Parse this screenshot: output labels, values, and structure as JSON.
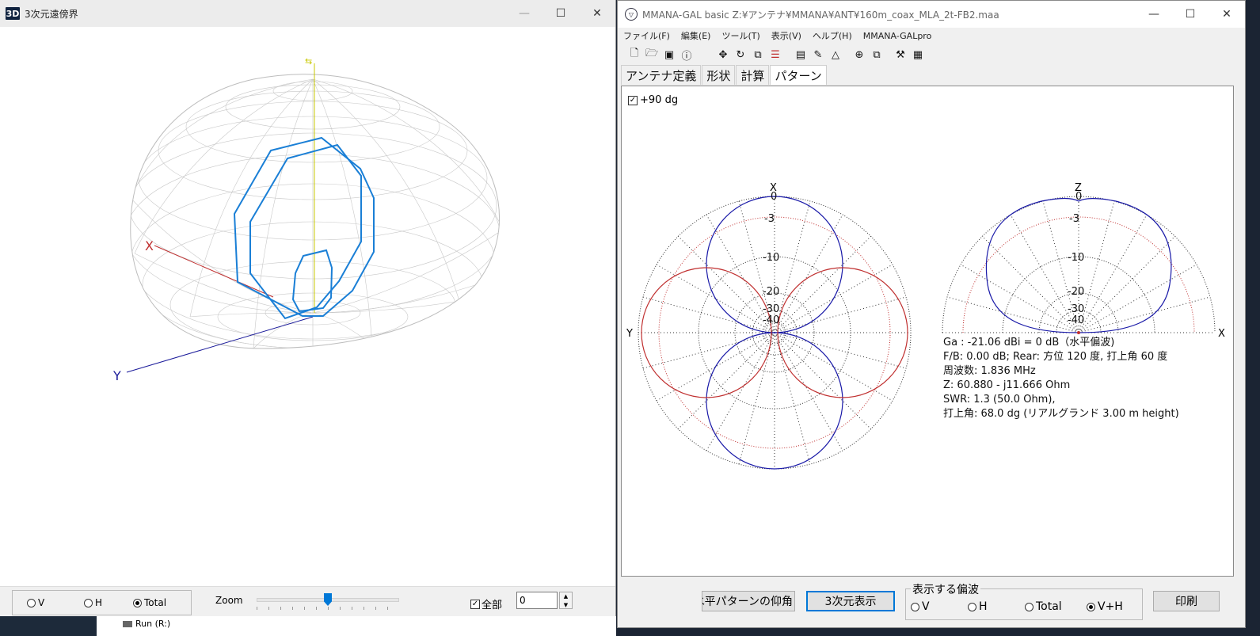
{
  "win3d": {
    "title": "3次元遠傍界",
    "icon_label": "3D",
    "axis_x": "X",
    "axis_y": "Y",
    "radio_v": "V",
    "radio_h": "H",
    "radio_total": "Total",
    "zoom_label": "Zoom",
    "zoom_level": 0.5,
    "all_checkbox_label": "全部",
    "spin_value": "0",
    "task_run_label": "Run (R:)"
  },
  "mmana": {
    "title": "MMANA-GAL basic Z:¥アンテナ¥MMANA¥ANT¥160m_coax_MLA_2t-FB2.maa",
    "menu": [
      "ファイル(F)",
      "編集(E)",
      "ツール(T)",
      "表示(V)",
      "ヘルプ(H)",
      "MMANA-GALpro"
    ],
    "tabs": [
      "アンテナ定義",
      "形状",
      "計算",
      "パターン"
    ],
    "check_90": "+90 dg",
    "horiz_plot": {
      "top_label": "X",
      "left_label": "Y",
      "ring_labels": [
        "0",
        "-3",
        "-10",
        "-20",
        "-30",
        "-40"
      ]
    },
    "vert_plot": {
      "top_label": "Z",
      "right_label": "X",
      "ring_labels": [
        "0",
        "-3",
        "-10",
        "-20",
        "-30",
        "-40"
      ]
    },
    "info": {
      "line1": "Ga : -21.06 dBi = 0 dB（水平偏波)",
      "line2": "F/B: 0.00 dB; Rear: 方位 120 度, 打上角 60 度",
      "line3": "周波数: 1.836 MHz",
      "line4": "Z: 60.880 - j11.666 Ohm",
      "line5": "SWR: 1.3 (50.0 Ohm),",
      "line6": "打上角: 68.0 dg (リアルグランド  3.00 m height)"
    },
    "btn_elev": "水平パターンの仰角",
    "btn_3d": "3次元表示",
    "pol_legend": "表示する偏波",
    "pol_v": "V",
    "pol_h": "H",
    "pol_total": "Total",
    "pol_vh": "V+H",
    "btn_print": "印刷"
  },
  "colors": {
    "wire": "#1a7fd6",
    "vpol": "#1a1aa8",
    "hpol": "#c03030",
    "mesh": "#c8c8c8"
  }
}
